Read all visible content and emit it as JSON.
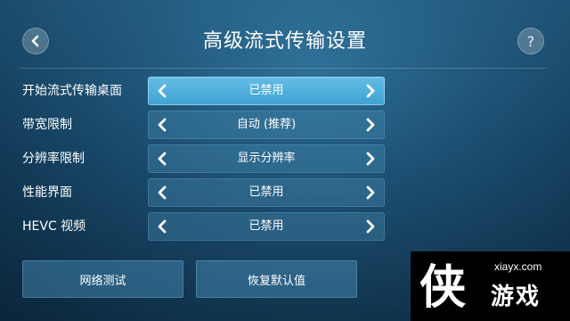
{
  "header": {
    "title": "高级流式传输设置",
    "back_icon": "chevron-left-icon",
    "help_label": "?"
  },
  "settings": [
    {
      "label": "开始流式传输桌面",
      "value": "已禁用",
      "active": true
    },
    {
      "label": "带宽限制",
      "value": "自动 (推荐)",
      "active": false
    },
    {
      "label": "分辨率限制",
      "value": "显示分辨率",
      "active": false
    },
    {
      "label": "性能界面",
      "value": "已禁用",
      "active": false
    },
    {
      "label": "HEVC 视频",
      "value": "已禁用",
      "active": false
    }
  ],
  "buttons": {
    "network_test": "网络测试",
    "restore_defaults": "恢复默认值"
  },
  "watermark": {
    "glyph": "侠",
    "url": "xiayx.com",
    "name": "游戏"
  },
  "colors": {
    "background": "#1c4f72",
    "active_selector": "#4fb0dc",
    "selector": "#3b7ea6"
  }
}
